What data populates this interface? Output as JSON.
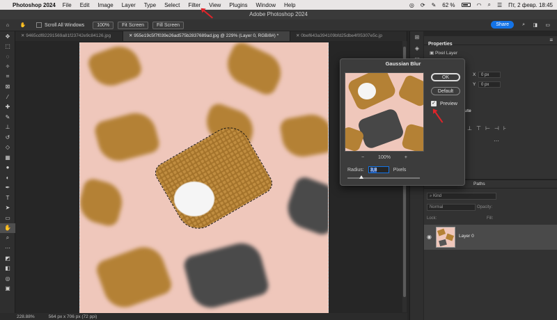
{
  "menubar": {
    "app": "Photoshop 2024",
    "items": [
      "File",
      "Edit",
      "Image",
      "Layer",
      "Type",
      "Select",
      "Filter",
      "View",
      "Plugins",
      "Window",
      "Help"
    ],
    "battery": "62 %",
    "datetime": "Пт, 2 февр.  18:45"
  },
  "window": {
    "title": "Adobe Photoshop 2024"
  },
  "options": {
    "scroll_all_label": "Scroll All Windows",
    "zoom_value": "100%",
    "fit_screen_label": "Fit Screen",
    "fill_screen_label": "Fill Screen",
    "share_label": "Share"
  },
  "tabs": [
    {
      "label": "9465cdf82291569a81f23742e9c84126.jpg",
      "active": false
    },
    {
      "label": "955e19c5f7f039e26ad575b2837689ad.jpg @ 229% (Layer 0, RGB/8#) *",
      "active": true
    },
    {
      "label": "0bef643a394109bfd25dbe4f05307e5c.jp",
      "active": false
    }
  ],
  "status": {
    "zoom": "228.88%",
    "dimensions": "564 px x 706 px (72 ppi)"
  },
  "properties": {
    "tab": "Properties",
    "type": "Pixel Layer",
    "x_label": "X",
    "x_value": "0 px",
    "y_label": "Y",
    "y_value": "0 px",
    "section_partial": "ute"
  },
  "layers": {
    "tab_paths": "Paths",
    "kind_placeholder": "Kind",
    "blend_mode": "Normal",
    "opacity_label": "Opacity:",
    "lock_label": "Lock:",
    "fill_label": "Fill:",
    "layer_name": "Layer 0"
  },
  "dialog": {
    "title": "Gaussian Blur",
    "ok_label": "OK",
    "default_label": "Default",
    "preview_label": "Preview",
    "preview_checked": true,
    "zoom_value": "100%",
    "radius_label": "Radius:",
    "radius_value": "3,8",
    "radius_unit": "Pixels"
  },
  "icons": {
    "zoom_out": "−",
    "zoom_in": "+"
  },
  "colors": {
    "accent": "#1473e6",
    "annotation_arrow": "#e0242a",
    "photo_background": "#efc7bb"
  }
}
